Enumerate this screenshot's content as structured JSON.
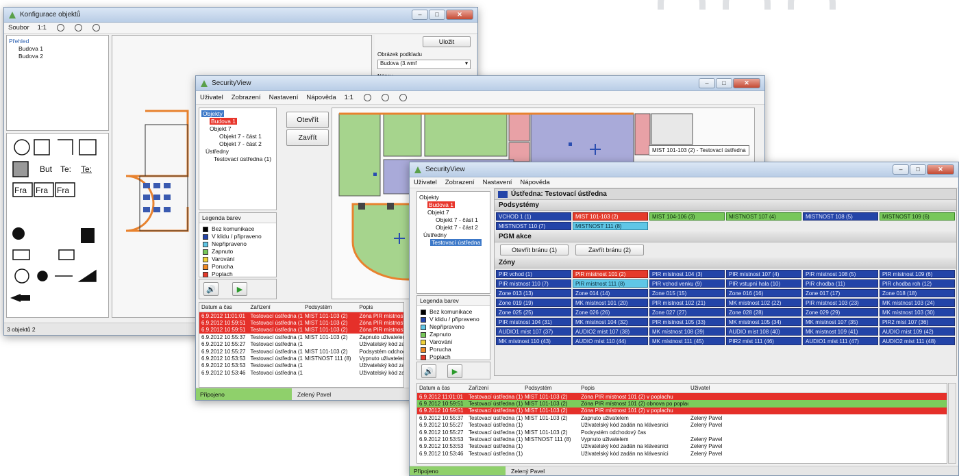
{
  "win1": {
    "title": "Konfigurace objektů",
    "menu": [
      "Soubor",
      "1:1"
    ],
    "tree": [
      "Přehled",
      "Budova 1",
      "Budova 2"
    ],
    "button": "Uložit",
    "right_label": "Obrázek podkladu",
    "right_select": "Budova (3.wmf",
    "right_label2": "Název",
    "palette_texts": [
      "But",
      "Te:",
      "Te:",
      "Fra",
      "Fra",
      "Fra"
    ],
    "status": "3 objektů 2"
  },
  "win2": {
    "title": "SecurityView",
    "menu": [
      "Uživatel",
      "Zobrazení",
      "Nastavení",
      "Nápověda",
      "1:1"
    ],
    "tree": [
      "Objekty",
      "Budova 1",
      "Objekt 7",
      "Objekt 7 - část 1",
      "Objekt 7 - část 2",
      "Ústředny",
      "Testovací ústředna (1)"
    ],
    "btn_open": "Otevřít",
    "btn_close": "Zavřít",
    "legend_title": "Legenda barev",
    "legend": [
      {
        "label": "Bez komunikace",
        "color": "#000000"
      },
      {
        "label": "V klidu / připraveno",
        "color": "#2344a8"
      },
      {
        "label": "Nepřipraveno",
        "color": "#5fc6e6"
      },
      {
        "label": "Zapnuto",
        "color": "#77c75a"
      },
      {
        "label": "Varování",
        "color": "#f0d23a"
      },
      {
        "label": "Porucha",
        "color": "#f08a24"
      },
      {
        "label": "Poplach",
        "color": "#e53a2b"
      }
    ],
    "tooltip": "MIST 101-103 (2) - Testovací ústředna",
    "log_headers": [
      "Datum a čas",
      "Zařízení",
      "Podsystém",
      "Popis"
    ],
    "log_rows": [
      {
        "c": "red",
        "v": [
          "6.9.2012 11:01:01",
          "Testovací ústředna (1)",
          "MIST 101-103 (2)",
          "Zóna PIR místnost"
        ]
      },
      {
        "c": "red",
        "v": [
          "6.9.2012 10:59:51",
          "Testovací ústředna (1)",
          "MIST 101-103 (2)",
          "Zóna PIR místnost"
        ]
      },
      {
        "c": "red",
        "v": [
          "6.9.2012 10:59:51",
          "Testovací ústředna (1)",
          "MIST 101-103 (2)",
          "Zóna PIR místnost"
        ]
      },
      {
        "c": "",
        "v": [
          "6.9.2012 10:55:37",
          "Testovací ústředna (1)",
          "MIST 101-103 (2)",
          "Zapnuto uživatelem"
        ]
      },
      {
        "c": "",
        "v": [
          "6.9.2012 10:55:27",
          "Testovací ústředna (1)",
          "",
          "Uživatelský kód zadán"
        ]
      },
      {
        "c": "",
        "v": [
          "6.9.2012 10:55:27",
          "Testovací ústředna (1)",
          "MIST 101-103 (2)",
          "Podsystém odchodový"
        ]
      },
      {
        "c": "",
        "v": [
          "6.9.2012 10:53:53",
          "Testovací ústředna (1)",
          "MISTNOST 111 (8)",
          "Vypnuto uživatelem"
        ]
      },
      {
        "c": "",
        "v": [
          "6.9.2012 10:53:53",
          "Testovací ústředna (1)",
          "",
          "Uživatelský kód zad"
        ]
      },
      {
        "c": "",
        "v": [
          "6.9.2012 10:53:46",
          "Testovací ústředna (1)",
          "",
          "Uživatelský kód zad"
        ]
      }
    ],
    "status_left": "Připojeno",
    "status_user": "Zelený Pavel"
  },
  "win3": {
    "title": "SecurityView",
    "menu": [
      "Uživatel",
      "Zobrazení",
      "Nastavení",
      "Nápověda"
    ],
    "tree": [
      "Objekty",
      "Budova 1",
      "Objekt 7",
      "Objekt 7 - část 1",
      "Objekt 7 - část 2",
      "Ústředny",
      "Testovací ústředna"
    ],
    "legend_title": "Legenda barev",
    "panel_header": "Ústředna: Testovací ústředna",
    "subsystems_title": "Podsystémy",
    "subsystems": [
      {
        "t": "VCHOD 1 (1)",
        "c": "blue"
      },
      {
        "t": "MIST 101-103 (2)",
        "c": "red"
      },
      {
        "t": "MIST 104-106 (3)",
        "c": "green"
      },
      {
        "t": "MISTNOST 107 (4)",
        "c": "green"
      },
      {
        "t": "MISTNOST 108 (5)",
        "c": "blue"
      },
      {
        "t": "MISTNOST 109 (6)",
        "c": "green"
      },
      {
        "t": "MISTNOST 110 (7)",
        "c": "blue"
      },
      {
        "t": "MISTNOST 111 (8)",
        "c": "cyan"
      }
    ],
    "pgm_title": "PGM akce",
    "pgm_open": "Otevřít bránu (1)",
    "pgm_close": "Zavřít bránu (2)",
    "zones_title": "Zóny",
    "zones": [
      {
        "t": "PIR vchod (1)",
        "c": "blue"
      },
      {
        "t": "PIR místnost 101 (2)",
        "c": "red"
      },
      {
        "t": "PIR místnost 104 (3)",
        "c": "blue"
      },
      {
        "t": "PIR místnost 107 (4)",
        "c": "blue"
      },
      {
        "t": "PIR místnost 108 (5)",
        "c": "blue"
      },
      {
        "t": "PIR místnost 109 (6)",
        "c": "blue"
      },
      {
        "t": "PIR místnost 110 (7)",
        "c": "blue"
      },
      {
        "t": "PIR místnost 111 (8)",
        "c": "cyan"
      },
      {
        "t": "PIR vchod venku (9)",
        "c": "blue"
      },
      {
        "t": "PIR vstupní hala (10)",
        "c": "blue"
      },
      {
        "t": "PIR chodba (11)",
        "c": "blue"
      },
      {
        "t": "PIR chodba roh (12)",
        "c": "blue"
      },
      {
        "t": "Zone 013 (13)",
        "c": "blue"
      },
      {
        "t": "Zone 014 (14)",
        "c": "blue"
      },
      {
        "t": "Zone 015 (15)",
        "c": "blue"
      },
      {
        "t": "Zone 016 (16)",
        "c": "blue"
      },
      {
        "t": "Zone 017 (17)",
        "c": "blue"
      },
      {
        "t": "Zone 018 (18)",
        "c": "blue"
      },
      {
        "t": "Zone 019 (19)",
        "c": "blue"
      },
      {
        "t": "MK místnost 101 (20)",
        "c": "blue"
      },
      {
        "t": "PIR místnost 102 (21)",
        "c": "blue"
      },
      {
        "t": "MK místnost 102 (22)",
        "c": "blue"
      },
      {
        "t": "PIR místnost 103 (23)",
        "c": "blue"
      },
      {
        "t": "MK místnost 103 (24)",
        "c": "blue"
      },
      {
        "t": "Zone 025 (25)",
        "c": "blue"
      },
      {
        "t": "Zone 026 (26)",
        "c": "blue"
      },
      {
        "t": "Zone 027 (27)",
        "c": "blue"
      },
      {
        "t": "Zone 028 (28)",
        "c": "blue"
      },
      {
        "t": "Zone 029 (29)",
        "c": "blue"
      },
      {
        "t": "MK místnost 103 (30)",
        "c": "blue"
      },
      {
        "t": "PIR místnost 104 (31)",
        "c": "blue"
      },
      {
        "t": "MK místnost 104 (32)",
        "c": "blue"
      },
      {
        "t": "PIR místnost 105 (33)",
        "c": "blue"
      },
      {
        "t": "MK místnost 105 (34)",
        "c": "blue"
      },
      {
        "t": "MK místnost 107 (35)",
        "c": "blue"
      },
      {
        "t": "PIR2 míst 107 (36)",
        "c": "blue"
      },
      {
        "t": "AUDIO1 míst 107 (37)",
        "c": "blue"
      },
      {
        "t": "AUDIO2 míst 107 (38)",
        "c": "blue"
      },
      {
        "t": "MK místnost 108 (39)",
        "c": "blue"
      },
      {
        "t": "AUDIO míst 108 (40)",
        "c": "blue"
      },
      {
        "t": "MK místnost 109 (41)",
        "c": "blue"
      },
      {
        "t": "AUDIO míst 109 (42)",
        "c": "blue"
      },
      {
        "t": "MK místnost 110 (43)",
        "c": "blue"
      },
      {
        "t": "AUDIO míst 110 (44)",
        "c": "blue"
      },
      {
        "t": "MK místnost 111 (45)",
        "c": "blue"
      },
      {
        "t": "PIR2 míst 111 (46)",
        "c": "blue"
      },
      {
        "t": "AUDIO1 míst 111 (47)",
        "c": "blue"
      },
      {
        "t": "AUDIO2 míst 111 (48)",
        "c": "blue"
      }
    ],
    "log_headers": [
      "Datum a čas",
      "Zařízení",
      "Podsystém",
      "Popis",
      "Uživatel"
    ],
    "log_rows": [
      {
        "c": "red",
        "v": [
          "6.9.2012 11:01:01",
          "Testovací ústředna (1)",
          "MIST 101-103 (2)",
          "Zóna PIR místnost 101 (2) v poplachu",
          ""
        ]
      },
      {
        "c": "green",
        "v": [
          "6.9.2012 10:59:51",
          "Testovací ústředna (1)",
          "MIST 101-103 (2)",
          "Zóna PIR místnost 101 (2) obnova po poplachu",
          ""
        ]
      },
      {
        "c": "red",
        "v": [
          "6.9.2012 10:59:51",
          "Testovací ústředna (1)",
          "MIST 101-103 (2)",
          "Zóna PIR místnost 101 (2) v poplachu",
          ""
        ]
      },
      {
        "c": "",
        "v": [
          "6.9.2012 10:55:37",
          "Testovací ústředna (1)",
          "MIST 101-103 (2)",
          "Zapnuto uživatelem",
          "Zelený Pavel"
        ]
      },
      {
        "c": "",
        "v": [
          "6.9.2012 10:55:27",
          "Testovací ústředna (1)",
          "",
          "Uživatelský kód zadán na klávesnici",
          "Zelený Pavel"
        ]
      },
      {
        "c": "",
        "v": [
          "6.9.2012 10:55:27",
          "Testovací ústředna (1)",
          "MIST 101-103 (2)",
          "Podsystém odchodový čas",
          ""
        ]
      },
      {
        "c": "",
        "v": [
          "6.9.2012 10:53:53",
          "Testovací ústředna (1)",
          "MISTNOST 111 (8)",
          "Vypnuto uživatelem",
          "Zelený Pavel"
        ]
      },
      {
        "c": "",
        "v": [
          "6.9.2012 10:53:53",
          "Testovací ústředna (1)",
          "",
          "Uživatelský kód zadán na klávesnici",
          "Zelený Pavel"
        ]
      },
      {
        "c": "",
        "v": [
          "6.9.2012 10:53:46",
          "Testovací ústředna (1)",
          "",
          "Uživatelský kód zadán na klávesnici",
          "Zelený Pavel"
        ]
      }
    ],
    "status_left": "Připojeno",
    "status_user": "Zelený Pavel"
  }
}
